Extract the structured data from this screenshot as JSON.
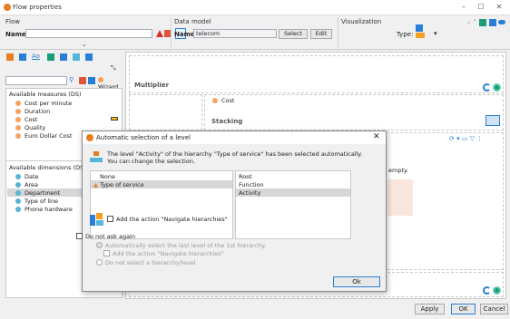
{
  "window": {
    "title": "Flow properties"
  },
  "flow": {
    "section_label": "Flow",
    "name_label": "Name:",
    "name_value": ""
  },
  "data_model": {
    "section_label": "Data model",
    "name_label": "Name:",
    "name_value": "telecom",
    "select_label": "Select",
    "edit_label": "Edit"
  },
  "visualization": {
    "section_label": "Visualization",
    "type_label": "Type:"
  },
  "left_panel": {
    "wizard_label": "Wizard",
    "tab_text": "Ao",
    "measures_header": "Available measures (DS)",
    "measures": [
      "Cost per minute",
      "Duration",
      "Cost",
      "Quality",
      "Euro Dollar Cost"
    ],
    "dimensions_header": "Available dimensions (DS)",
    "dimensions": [
      "Date",
      "Area",
      "Department",
      "Type of line",
      "Phone hardware"
    ]
  },
  "main": {
    "multiplier_label": "Multiplier",
    "cost_chip": "Cost",
    "stacking_label": "Stacking",
    "empty_fragment": "empty."
  },
  "dialog": {
    "title": "Automatic selection of a level",
    "message_line1": "The level \"Activity\" of the hierarchy \"Type of service\" has been selected automatically.",
    "message_line2": "You can change the selection.",
    "hierarchies": [
      "None",
      "Type of service"
    ],
    "levels": [
      "Root",
      "Function",
      "Activity"
    ],
    "navigate_label": "Add the action \"Navigate hierarchies\"",
    "do_not_ask_label": "Do not ask again",
    "opt_auto_label": "Automatically select the last level of the 1st hierarchy.",
    "opt_auto_sub_label": "Add the action \"Navigate hierarchies\"",
    "opt_none_label": "Do not select a hierarchy/level.",
    "ok_label": "Ok"
  },
  "footer": {
    "apply": "Apply",
    "ok": "OK",
    "cancel": "Cancel"
  },
  "colors": {
    "accent_orange": "#e67e22",
    "accent_blue": "#2a7fd4",
    "teal": "#1a9b7a",
    "warning_red": "#d93025"
  }
}
